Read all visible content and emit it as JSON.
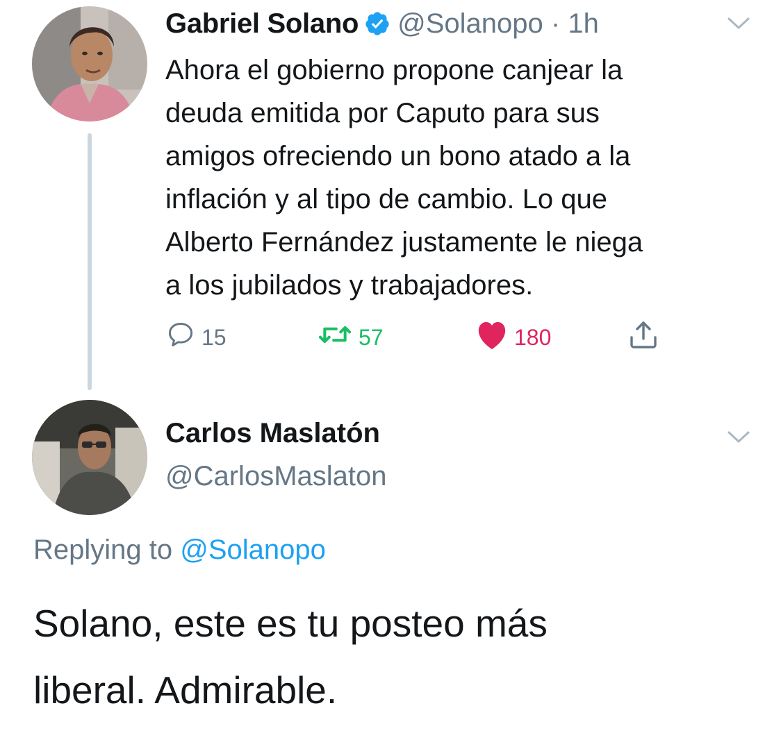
{
  "tweet": {
    "author": {
      "name": "Gabriel Solano",
      "verified": true,
      "handle": "@Solanopo",
      "separator": "·",
      "time": "1h",
      "avatar": "profile-photo-man-pink-shirt"
    },
    "text": "Ahora el gobierno propone canjear la\ndeuda emitida por Caputo para sus\namigos ofreciendo un bono atado a la\ninflación y al tipo de cambio. Lo que\nAlberto Fernández justamente le niega\na los jubilados y trabajadores.",
    "actions": {
      "reply": {
        "icon": "reply-icon",
        "count": "15"
      },
      "retweet": {
        "icon": "retweet-icon",
        "count": "57"
      },
      "like": {
        "icon": "heart-icon",
        "count": "180",
        "liked": true
      },
      "share": {
        "icon": "share-icon"
      }
    }
  },
  "reply": {
    "author": {
      "name": "Carlos Maslatón",
      "handle": "@CarlosMaslaton",
      "avatar": "profile-photo-man-dark-jacket"
    },
    "replying_to_label": "Replying to",
    "replying_to_handle": "@Solanopo",
    "text": "Solano, este es tu posteo más\nliberal. Admirable."
  },
  "colors": {
    "text": "#14171a",
    "secondary": "#657786",
    "link": "#1da1f2",
    "retweet": "#17bf63",
    "like": "#e0245e",
    "thread_line": "#ccd6dd",
    "caret": "#aab8c2"
  }
}
